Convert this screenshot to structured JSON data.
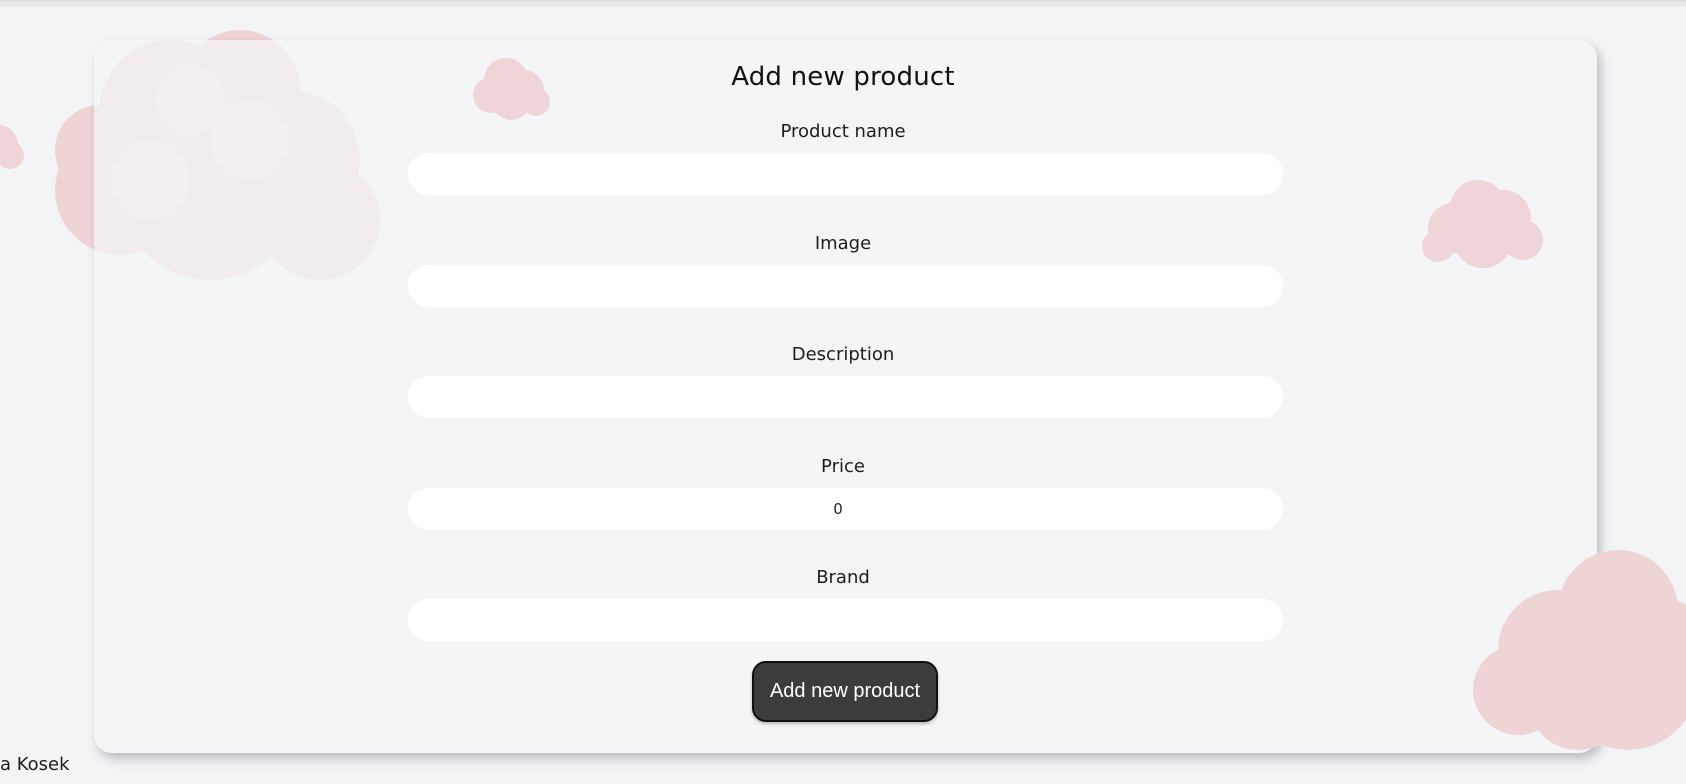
{
  "form": {
    "title": "Add new product",
    "fields": [
      {
        "label": "Product name",
        "value": ""
      },
      {
        "label": "Image",
        "value": ""
      },
      {
        "label": "Description",
        "value": ""
      },
      {
        "label": "Price",
        "value": "0"
      },
      {
        "label": "Brand",
        "value": ""
      }
    ],
    "submit_label": "Add new product"
  },
  "footer": {
    "text": "a Kosek"
  },
  "colors": {
    "background": "#f3f4f6",
    "card": "#f4f5f7",
    "button": "#3c3c3c",
    "cloud": "#f0d8da"
  }
}
